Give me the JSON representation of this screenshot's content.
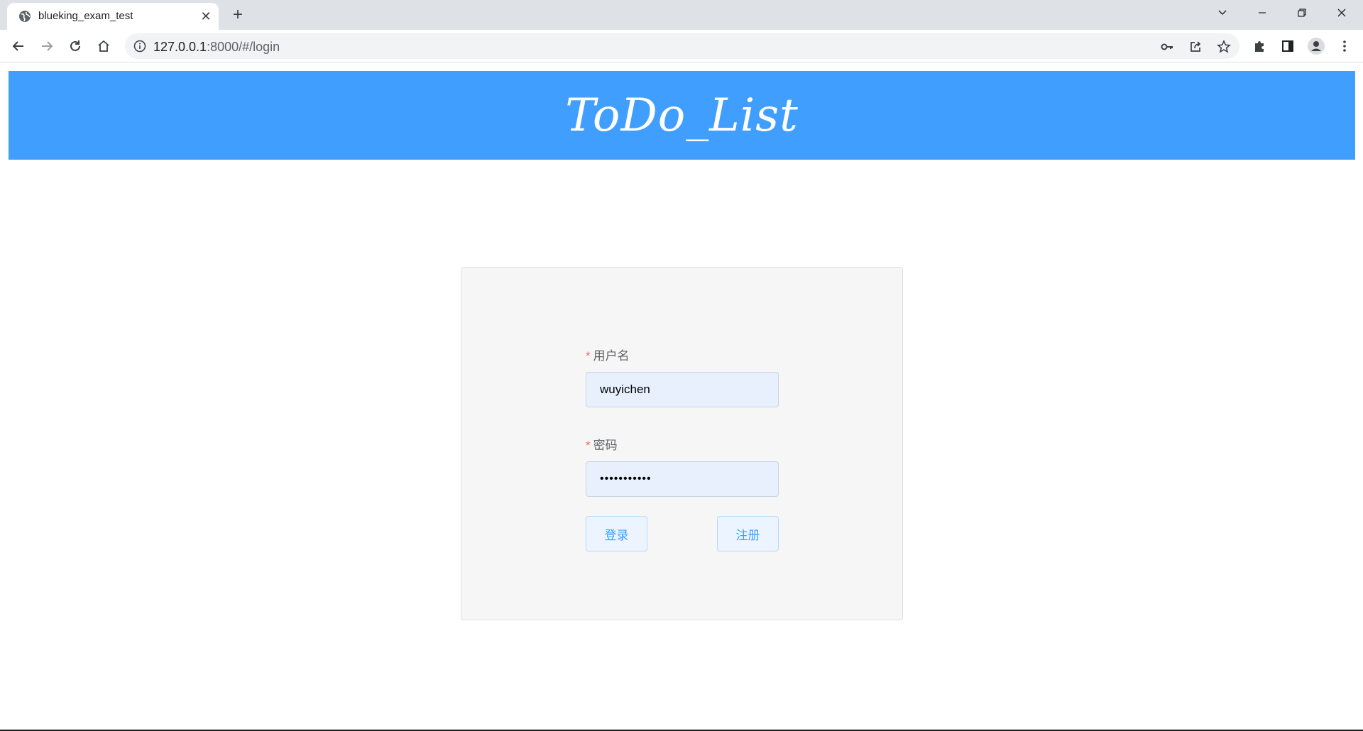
{
  "browser": {
    "tab_title": "blueking_exam_test",
    "tab_close": "✕",
    "new_tab": "+",
    "url_host": "127.0.0.1",
    "url_path": ":8000/#/login"
  },
  "page": {
    "header_title": "ToDo_List",
    "username_label": "用户名",
    "username_value": "wuyichen",
    "password_label": "密码",
    "password_value": "•••••••••••",
    "required_mark": "*",
    "login_button": "登录",
    "register_button": "注册"
  },
  "colors": {
    "accent": "#409eff",
    "header_bg": "#409eff",
    "card_bg": "#f6f6f6",
    "input_bg": "#e8f0fe",
    "required": "#f56c6c"
  }
}
